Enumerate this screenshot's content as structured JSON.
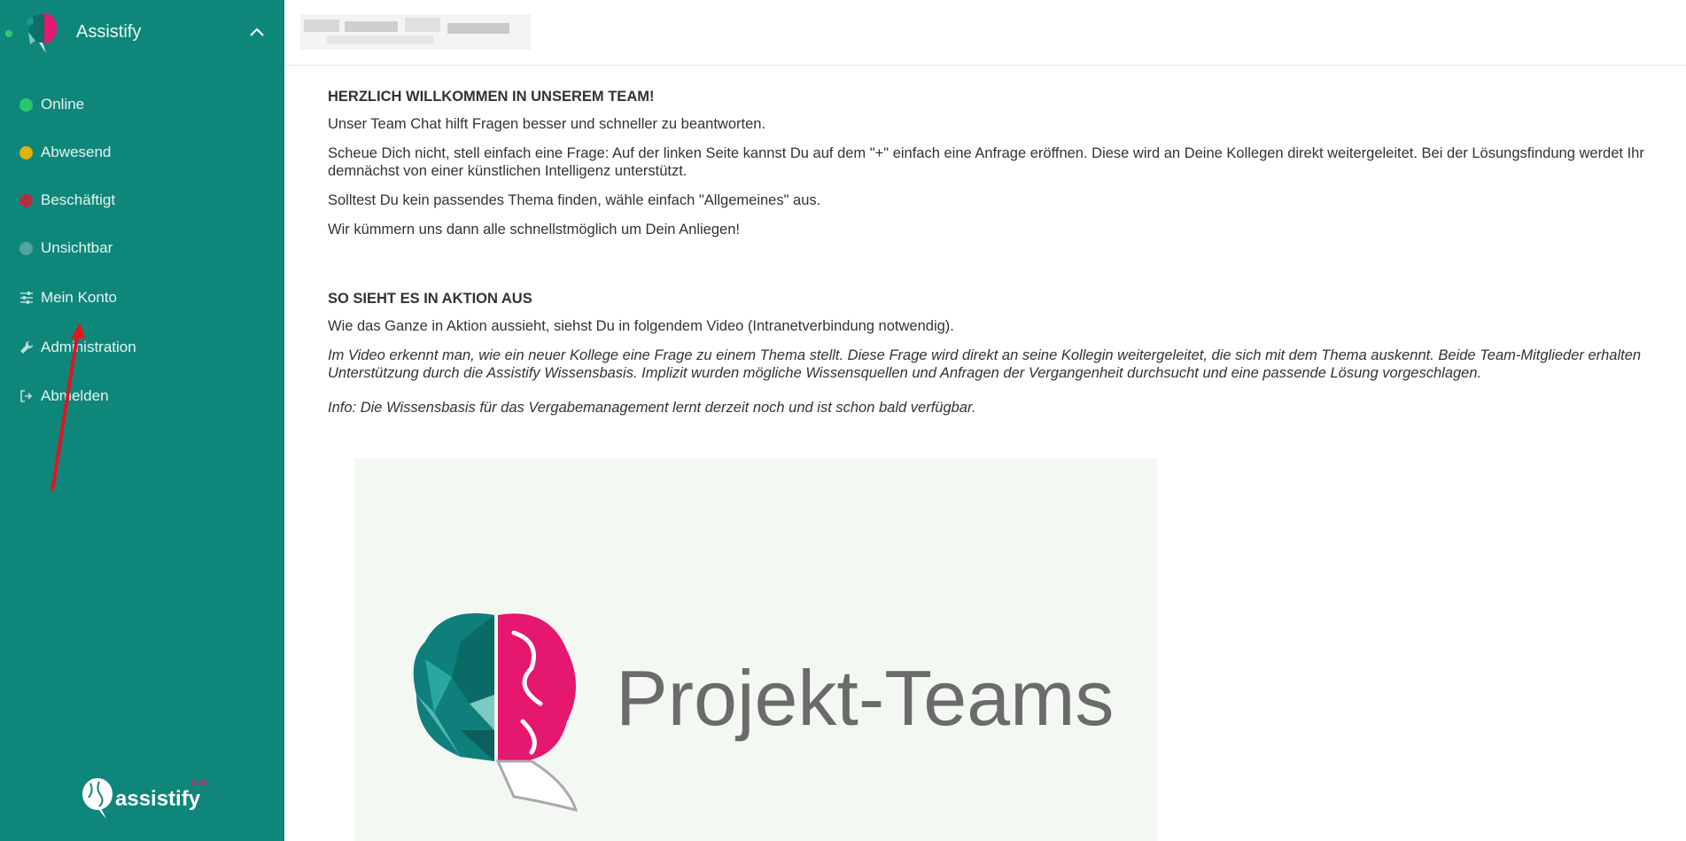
{
  "sidebar": {
    "brand_name": "Assistify",
    "items": [
      {
        "label": "Online",
        "color": "#2ecc71"
      },
      {
        "label": "Abwesend",
        "color": "#f5b800"
      },
      {
        "label": "Beschäftigt",
        "color": "#c8243a"
      },
      {
        "label": "Unsichtbar",
        "color": "#5aa9a0"
      },
      {
        "label": "Mein Konto",
        "icon": "sliders-icon"
      },
      {
        "label": "Administration",
        "icon": "wrench-icon"
      },
      {
        "label": "Abmelden",
        "icon": "sign-out-icon"
      }
    ],
    "footer_logo_text": "assistify",
    "footer_badge": "beta"
  },
  "main": {
    "section1_title": "HERZLICH WILLKOMMEN IN UNSEREM TEAM!",
    "p1": "Unser Team Chat hilft Fragen besser und schneller zu beantworten.",
    "p2": "Scheue Dich nicht, stell einfach eine Frage: Auf der linken Seite kannst Du auf dem \"+\" einfach eine Anfrage eröffnen. Diese wird an Deine Kollegen direkt weitergeleitet. Bei der Lösungsfindung werdet Ihr demnächst von einer künstlichen Intelligenz unterstützt.",
    "p3": "Solltest Du kein passendes Thema finden, wähle einfach \"Allgemeines\" aus.",
    "p4": "Wir kümmern uns dann alle schnellstmöglich um Dein Anliegen!",
    "section2_title": "SO SIEHT ES IN AKTION AUS",
    "p5": "Wie das Ganze in Aktion aussieht, siehst Du in folgendem Video (Intranetverbindung notwendig).",
    "p6": "Im Video erkennt man, wie ein neuer Kollege eine Frage zu einem Thema stellt. Diese Frage wird direkt an seine Kollegin weitergeleitet, die sich mit dem Thema auskennt. Beide Team-Mitglieder erhalten Unterstützung durch die Assistify Wissensbasis. Implizit wurden mögliche Wissensquellen und Anfragen der Vergangenheit durchsucht und eine passende Lösung vorgeschlagen.",
    "p7": "Info: Die Wissensbasis für das Vergabemanagement lernt derzeit noch und ist schon bald verfügbar.",
    "video_title": "Projekt-Teams"
  },
  "colors": {
    "sidebar_bg": "#0e877a",
    "brain_pink": "#e5176f",
    "brain_teal": "#0f7f7c",
    "arrow": "#e0161f"
  }
}
